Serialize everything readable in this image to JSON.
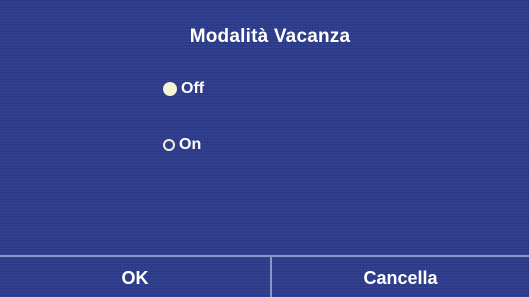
{
  "dialog": {
    "title": "Modalità Vacanza"
  },
  "options": [
    {
      "label": "Off",
      "selected": true
    },
    {
      "label": "On",
      "selected": false
    }
  ],
  "buttons": {
    "ok_label": "OK",
    "cancel_label": "Cancella"
  },
  "colors": {
    "background": "#2d3c8c",
    "text": "#ffffff",
    "radio_fill": "#f7f3d8",
    "divider": "#8b95c8"
  }
}
